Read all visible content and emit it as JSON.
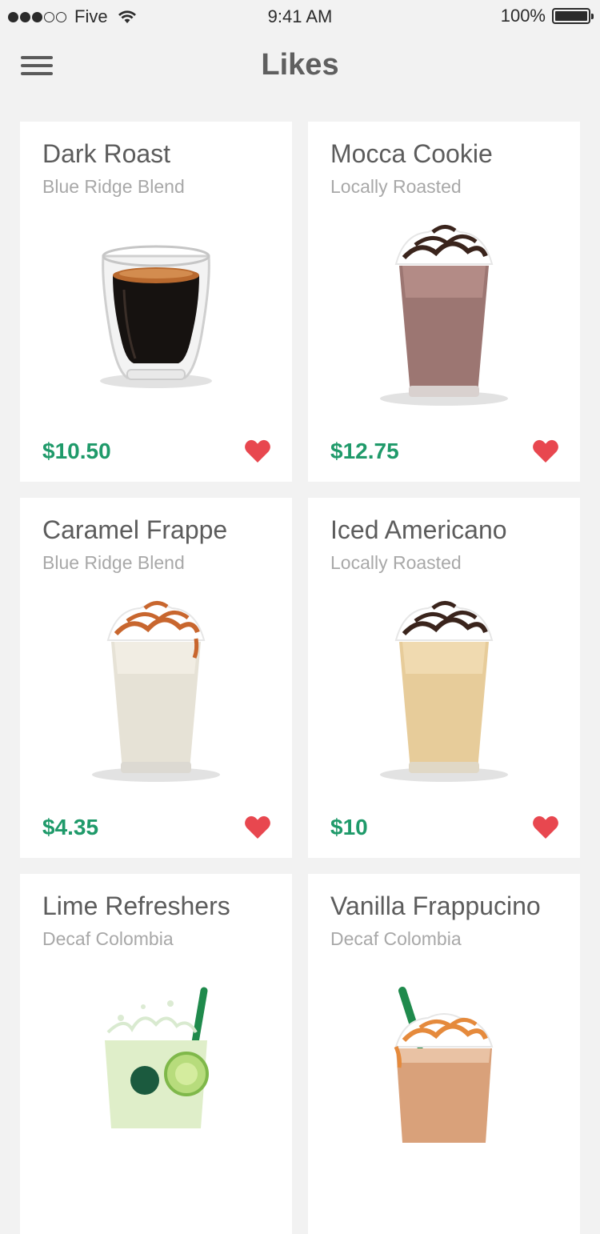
{
  "status_bar": {
    "carrier": "Five",
    "time": "9:41 AM",
    "battery": "100%",
    "signal_bars_filled": 3,
    "signal_bars_total": 5
  },
  "header": {
    "title": "Likes",
    "menu_icon": "hamburger-menu-icon"
  },
  "colors": {
    "price": "#1f9a6a",
    "heart": "#e8474f",
    "background": "#f2f2f2"
  },
  "items": [
    {
      "name": "Dark Roast",
      "subtitle": "Blue Ridge Blend",
      "price": "$10.50",
      "image": "espresso-glass",
      "liked": true
    },
    {
      "name": "Mocca Cookie",
      "subtitle": "Locally Roasted",
      "price": "$12.75",
      "image": "mocha-frappe",
      "liked": true
    },
    {
      "name": "Caramel Frappe",
      "subtitle": "Blue Ridge Blend",
      "price": "$4.35",
      "image": "caramel-frappe",
      "liked": true
    },
    {
      "name": "Iced Americano",
      "subtitle": "Locally Roasted",
      "price": "$10",
      "image": "iced-americano",
      "liked": true
    },
    {
      "name": "Lime Refreshers",
      "subtitle": "Decaf Colombia",
      "price": "",
      "image": "lime-refresher",
      "liked": true
    },
    {
      "name": "Vanilla Frappucino",
      "subtitle": "Decaf Colombia",
      "price": "",
      "image": "vanilla-frappuccino",
      "liked": true
    }
  ]
}
